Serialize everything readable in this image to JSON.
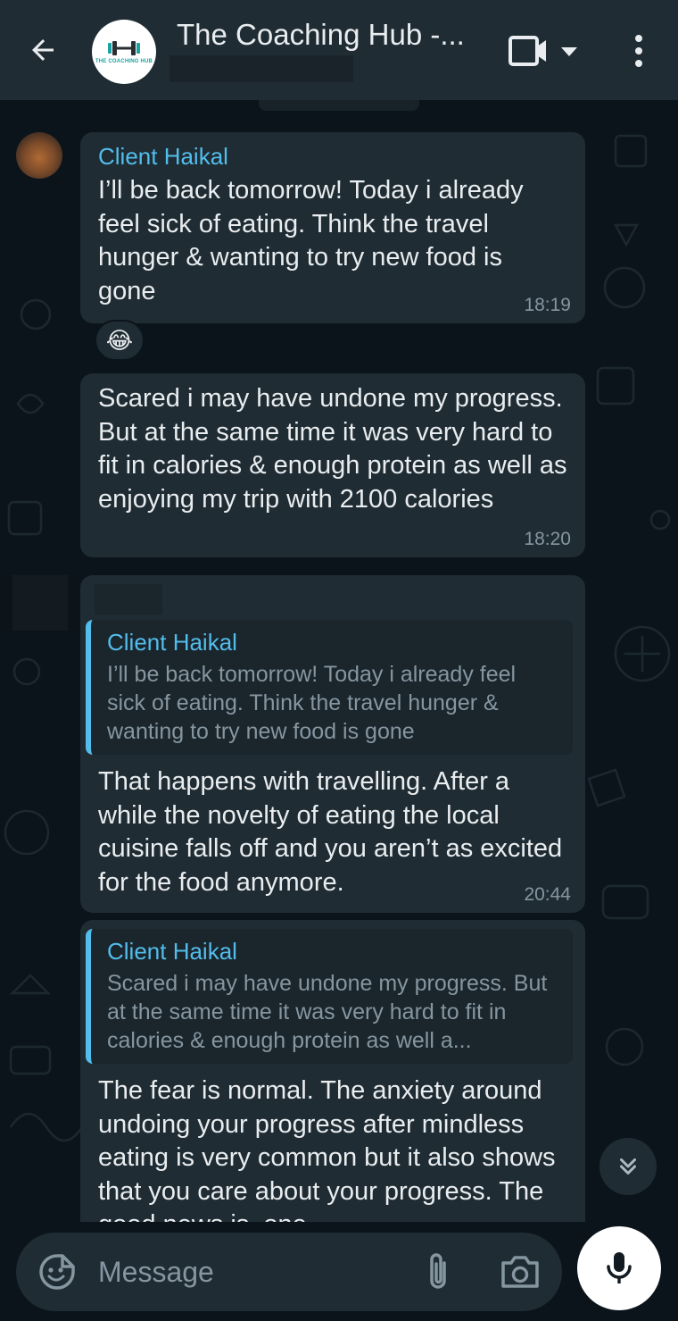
{
  "header": {
    "title": "The Coaching Hub -...",
    "group_logo_text": "THE COACHING HUB",
    "back_icon": "arrow-left-icon",
    "video_icon": "video-camera-icon",
    "menu_icon": "kebab-menu-icon"
  },
  "messages": [
    {
      "sender": "Client Haikal",
      "text": "I’ll be back tomorrow! Today i already feel sick of eating. Think the travel hunger & wanting to try new food is gone",
      "time": "18:19",
      "reaction": "😂"
    },
    {
      "text": "Scared i may have undone my progress. But at the same time it was very hard to fit in calories & enough protein as well as enjoying my trip with 2100 calories",
      "time": "18:20"
    },
    {
      "quote": {
        "sender": "Client Haikal",
        "text": "I’ll be back tomorrow! Today i already feel sick of eating. Think the travel hunger & wanting to try new food is gone"
      },
      "text": "That happens with travelling. After a while the novelty of eating the local cuisine falls off and you aren’t as excited for the food anymore.",
      "time": "20:44"
    },
    {
      "quote": {
        "sender": "Client Haikal",
        "text": "Scared i may have undone my progress. But at the same time it was very hard to fit in calories & enough protein as well a..."
      },
      "text": "The fear is normal. The anxiety around undoing your progress after mindless eating is very common but it also shows that you care about your progress. The good news is, one"
    }
  ],
  "composer": {
    "placeholder": "Message",
    "emoji_icon": "sticker-smiley-icon",
    "attach_icon": "paperclip-icon",
    "camera_icon": "camera-icon",
    "mic_icon": "microphone-icon"
  },
  "colors": {
    "background": "#0b141a",
    "header": "#1f2c34",
    "bubble": "#1f2c34",
    "accent": "#53bdeb",
    "muted": "#8696a0"
  }
}
